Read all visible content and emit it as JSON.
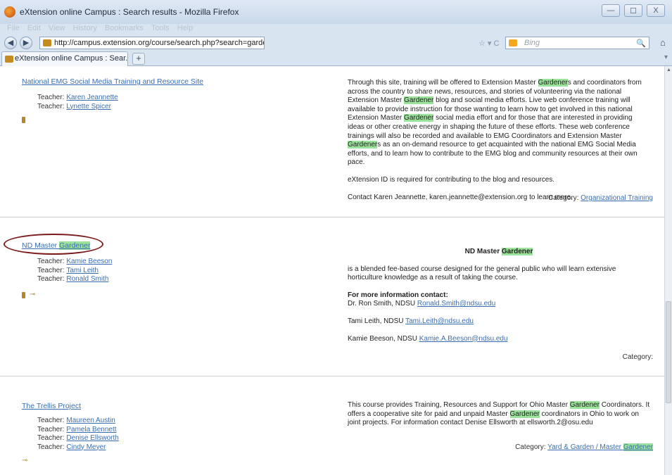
{
  "window": {
    "title": "eXtension online Campus : Search results - Mozilla Firefox",
    "minimize": "—",
    "maximize": "☐",
    "close": "X"
  },
  "menu": [
    "File",
    "Edit",
    "View",
    "History",
    "Bookmarks",
    "Tools",
    "Help"
  ],
  "nav": {
    "back": "◀",
    "forward": "▶",
    "url": "http://campus.extension.org/course/search.php?search=gardener",
    "reload_controls": "☆ ▾ C",
    "search_placeholder": "Bing",
    "search_glyph": "🔍",
    "home": "⌂"
  },
  "tabs": [
    {
      "label": "eXtension online Campus : Sear...",
      "close": "✕"
    }
  ],
  "new_tab": "+",
  "search_term": "Gardener",
  "courses": [
    {
      "title": "National EMG Social Media Training and Resource Site",
      "teachers": [
        {
          "label": "Teacher:",
          "name": "Karen Jeannette"
        },
        {
          "label": "Teacher:",
          "name": "Lynette Spicer"
        }
      ],
      "description_parts": [
        "Through this site, training will be offered to Extension Master ",
        "Gardener",
        "s and coordinators from across the country to share news, resources, and stories of volunteering via the national Extension Master ",
        "Gardener",
        " blog and social media efforts. Live web conference training will available to provide instruction for those wanting to learn how to get involved in this national Extension Master ",
        "Gardener",
        " social media effort and for those that are interested in providing ideas or other creative energy in shaping the future of these efforts. These web conference trainings will also be recorded and available to EMG Coordinators and Extension Master ",
        "Gardener",
        "s as an on-demand resource to get acquainted with the national EMG Social Media efforts, and to learn how to contribute to the EMG blog and community resources at their own pace."
      ],
      "note1": "eXtension ID is required for contributing to the blog and resources.",
      "note2": "Contact Karen Jeannette, karen.jeannette@extension.org to learn more.",
      "category_label": "Category:",
      "category": "Organizational Training"
    },
    {
      "title_prefix": "ND Master ",
      "title_highlight": "Gardener",
      "teachers": [
        {
          "label": "Teacher:",
          "name": "Kamie Beeson"
        },
        {
          "label": "Teacher:",
          "name": "Tami Leith"
        },
        {
          "label": "Teacher:",
          "name": "Ronald Smith"
        }
      ],
      "heading_prefix": "ND Master ",
      "heading_highlight": "Gardener",
      "summary": "is a blended fee-based course designed for the general public who will learn extensive horticulture knowledge as a result of taking the course.",
      "contact_heading": "For more information contact:",
      "contacts": [
        {
          "text": "Dr. Ron Smith, NDSU ",
          "email": "Ronald.Smith@ndsu.edu"
        },
        {
          "text": "Tami Leith, NDSU ",
          "email": "Tami.Leith@ndsu.edu"
        },
        {
          "text": "Kamie Beeson, NDSU ",
          "email": "Kamie.A.Beeson@ndsu.edu"
        }
      ],
      "category_label": "Category:"
    },
    {
      "title": "The Trellis Project",
      "teachers": [
        {
          "label": "Teacher:",
          "name": "Maureen Austin"
        },
        {
          "label": "Teacher:",
          "name": "Pamela Bennett"
        },
        {
          "label": "Teacher:",
          "name": "Denise Ellsworth"
        },
        {
          "label": "Teacher:",
          "name": "Cindy Meyer"
        }
      ],
      "description_parts": [
        "This course provides Training, Resources and Support for Ohio Master ",
        "Gardener",
        " Coordinators. It offers a cooperative site for paid and unpaid Master ",
        "Gardener",
        " coordinators in Ohio to work on joint projects. For information contact Denise Ellsworth at ellsworth.2@osu.edu"
      ],
      "category_label": "Category:",
      "category_prefix": "Yard & Garden / Master ",
      "category_highlight": "Gardener"
    }
  ],
  "icons": {
    "guest": "•",
    "key": "⊸"
  }
}
